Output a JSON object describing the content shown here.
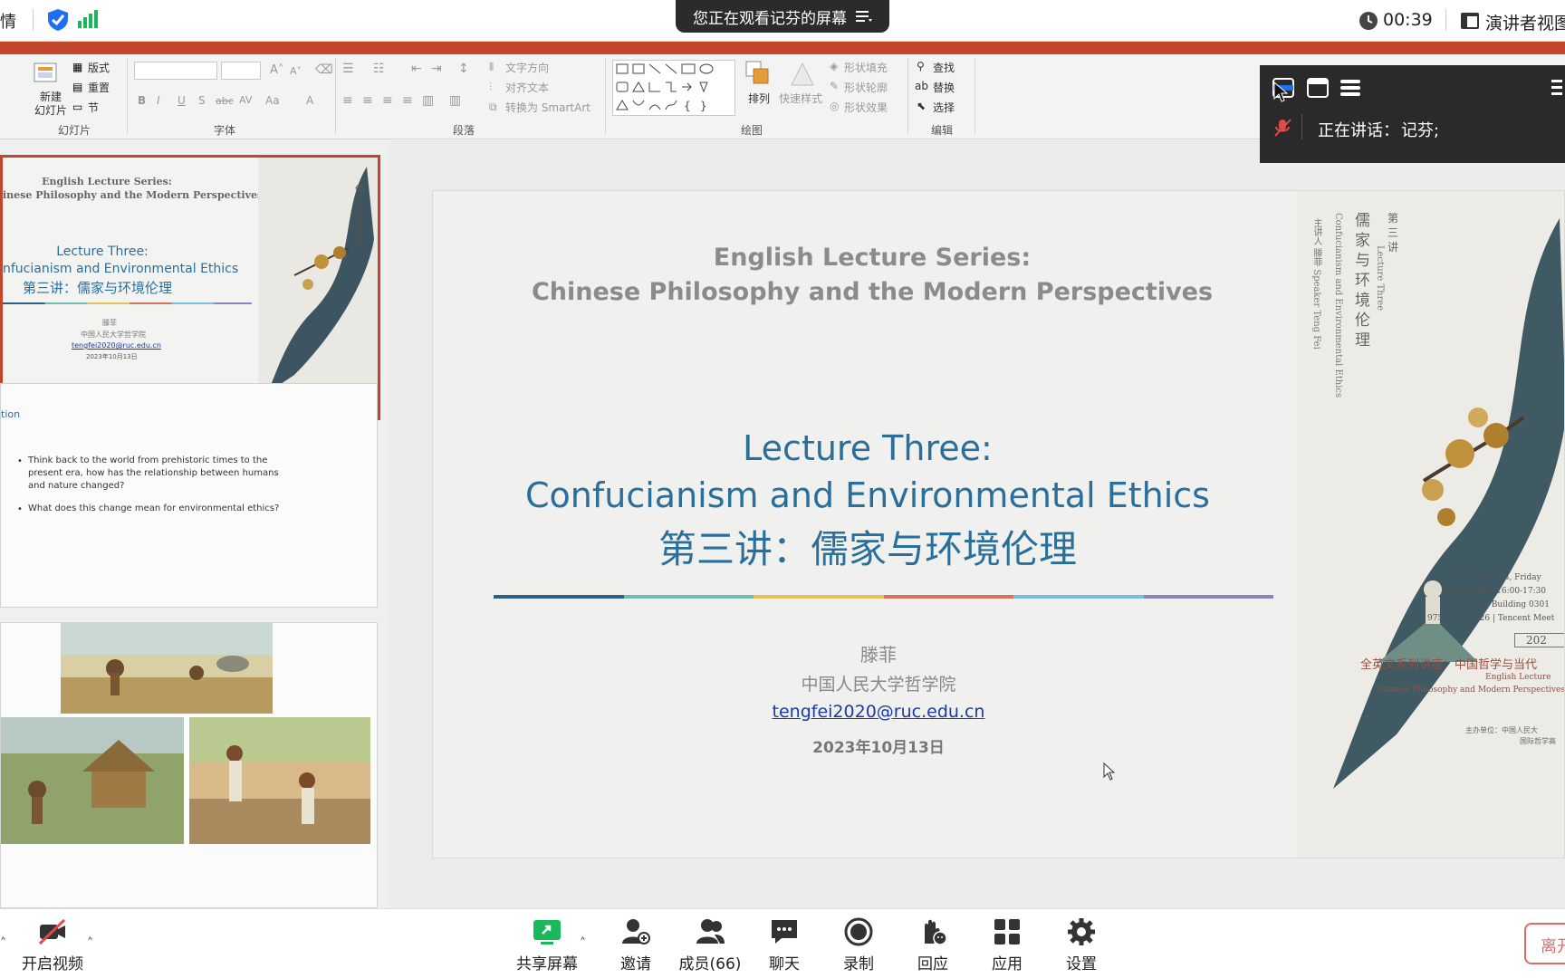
{
  "topbar": {
    "left_text": "情",
    "sharing_text": "您正在观看记芬的屏幕",
    "timer": "00:39",
    "view_label": "演讲者视图"
  },
  "ribbon": {
    "groups": [
      "幻灯片",
      "字体",
      "段落",
      "绘图",
      "编辑"
    ],
    "slides_group": {
      "new_slide": "新建\n幻灯片",
      "layout": "版式",
      "reset": "重置",
      "section": "节"
    },
    "paragraph": {
      "text_direction": "文字方向",
      "align_text": "对齐文本",
      "smartart": "转换为 SmartArt"
    },
    "drawing": {
      "arrange": "排列",
      "quick_styles": "快速样式",
      "shape_fill": "形状填充",
      "shape_outline": "形状轮廓",
      "shape_effects": "形状效果"
    },
    "editing": {
      "find": "查找",
      "replace": "替换",
      "select": "选择"
    }
  },
  "thumbnails": {
    "slide1": {
      "series": "English Lecture Series:",
      "subtitle": "inese Philosophy and the Modern Perspectives",
      "lecture": "Lecture Three:",
      "topic": "nfucianism and Environmental Ethics",
      "cn_title": "第三讲：儒家与环境伦理",
      "speaker": "滕菲",
      "org": "中国人民大学哲学院",
      "email": "tengfei2020@ruc.edu.cn",
      "date": "2023年10月13日"
    },
    "slide2": {
      "heading": "tion",
      "bullet1": "Think back to the world from prehistoric times to the present era, how has the relationship between humans and nature changed?",
      "bullet2": "What does this change mean for environmental ethics?"
    }
  },
  "slide": {
    "series_line1": "English Lecture Series:",
    "series_line2": "Chinese Philosophy and the Modern Perspectives",
    "lecture": "Lecture Three:",
    "topic": "Confucianism and Environmental Ethics",
    "cn_title": "第三讲：儒家与环境伦理",
    "speaker": "滕菲",
    "org": "中国人民大学哲学院",
    "email": "tengfei2020@ruc.edu.cn",
    "date": "2023年10月13日",
    "stripe_colors": [
      "#2b5f86",
      "#6cbfae",
      "#e6c15a",
      "#d9715f",
      "#78c1dc",
      "#8a85bd"
    ],
    "poster": {
      "cn_vertical1": "儒家与环境伦理",
      "cn_vertical2": "第三讲",
      "en_vertical1": "Lecture Three",
      "en_vertical2": "Confucianism and Environmental Ethics",
      "speaker_vertical": "主讲人 滕菲 Speaker Teng Fei",
      "date": "10.13, 2023, Friday",
      "time": "Beijing time 16:00-17:30",
      "place": "Lide Building 0301",
      "meeting": "975-9641-3826 | Tencent Meet",
      "year": "202",
      "series_cn": "全英文系列讲座：中国哲学与当代",
      "series_en1": "English Lecture",
      "series_en2": "Chinese Philosophy and Modern Perspectives",
      "host": "主办单位：中国人民大",
      "host2": "国际哲学高"
    }
  },
  "speaker_panel": {
    "speaking_label": "正在讲话：",
    "speaking_name": "记芬;"
  },
  "bottombar": {
    "video": "开启视频",
    "share": "共享屏幕",
    "invite": "邀请",
    "members": "成员(66)",
    "chat": "聊天",
    "record": "录制",
    "react": "回应",
    "apps": "应用",
    "settings": "设置",
    "leave": "离开"
  },
  "colors": {
    "ribbon_accent": "#c2462c",
    "title_blue": "#2a6f9c",
    "title_gray": "#8b8b8b",
    "share_green": "#19b85a"
  }
}
